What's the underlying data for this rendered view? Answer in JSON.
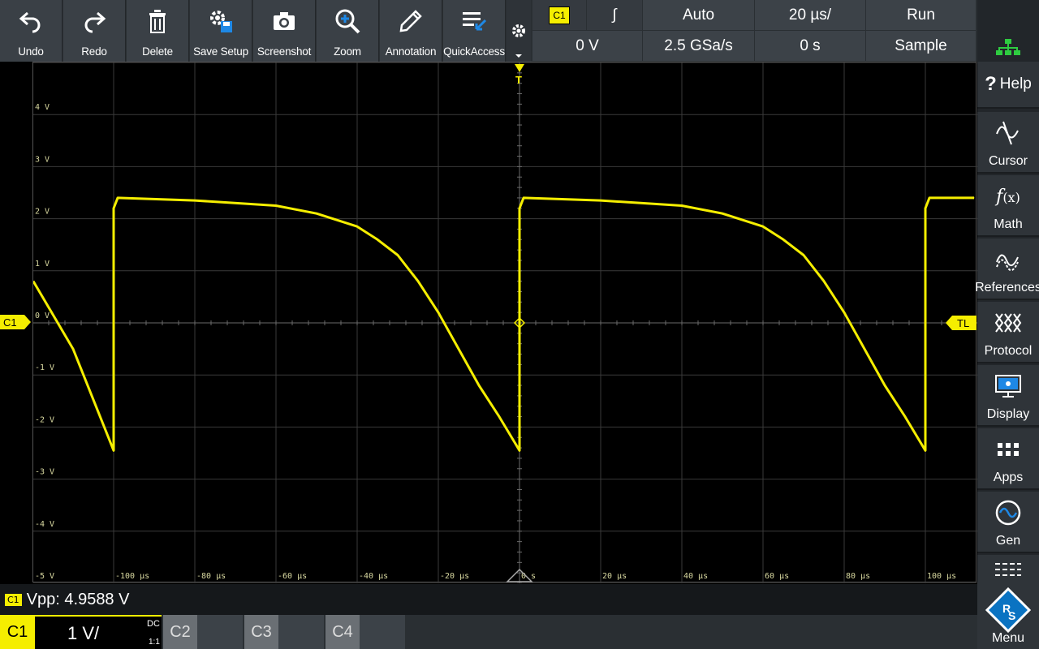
{
  "toolbar": {
    "buttons": [
      {
        "label": "Undo",
        "icon": "undo-icon"
      },
      {
        "label": "Redo",
        "icon": "redo-icon"
      },
      {
        "label": "Delete",
        "icon": "trash-icon"
      },
      {
        "label": "Save Setup",
        "icon": "save-setup-icon"
      },
      {
        "label": "Screenshot",
        "icon": "camera-icon"
      },
      {
        "label": "Zoom",
        "icon": "zoom-icon"
      },
      {
        "label": "Annotation",
        "icon": "pen-icon"
      },
      {
        "label": "QuickAccess",
        "icon": "quickaccess-icon"
      }
    ]
  },
  "status": {
    "trigger_channel": "C1",
    "trigger_slope": "∫",
    "trigger_mode": "Auto",
    "time_scale": "20 µs/",
    "run_state": "Run",
    "trigger_level": "0 V",
    "sample_rate": "2.5 GSa/s",
    "horizontal_position": "0 s",
    "acquisition_mode": "Sample"
  },
  "sidebar": {
    "items": [
      {
        "label": "Help",
        "icon": "help-icon"
      },
      {
        "label": "Cursor",
        "icon": "cursor-icon"
      },
      {
        "label": "Math",
        "icon": "math-icon"
      },
      {
        "label": "References",
        "icon": "references-icon"
      },
      {
        "label": "Protocol",
        "icon": "protocol-icon"
      },
      {
        "label": "Display",
        "icon": "display-icon"
      },
      {
        "label": "Apps",
        "icon": "apps-icon"
      },
      {
        "label": "Gen",
        "icon": "generator-icon"
      },
      {
        "label": "Menu",
        "icon": "rs-logo-icon"
      }
    ]
  },
  "scope": {
    "markers": {
      "channel": "C1",
      "trigger_top": "T",
      "trigger_level": "TL"
    },
    "colors": {
      "trace": "#f5ee00",
      "grid": "#3a3a3a",
      "axis": "#6a6a6a"
    }
  },
  "chart_data": {
    "type": "line",
    "y_tick_labels": [
      "4 V",
      "3 V",
      "2 V",
      "1 V",
      "0 V",
      "-1 V",
      "-2 V",
      "-3 V",
      "-4 V",
      "-5 V"
    ],
    "x_tick_labels": [
      "-100 µs",
      "-80 µs",
      "-60 µs",
      "-40 µs",
      "-20 µs",
      "0 s",
      "20 µs",
      "40 µs",
      "60 µs",
      "80 µs",
      "100 µs"
    ],
    "ylim": [
      -5,
      5
    ],
    "xlim": [
      -120,
      112
    ],
    "grid": true,
    "series": [
      {
        "x": [
          -120,
          -110,
          -100,
          -100,
          -99,
          -80,
          -60,
          -50,
          -40,
          -35,
          -30,
          -25,
          -20,
          -15,
          -10,
          -5,
          0,
          0,
          1,
          20,
          40,
          50,
          60,
          65,
          70,
          75,
          80,
          85,
          90,
          95,
          100,
          100,
          101,
          112
        ],
        "y": [
          0.8,
          -0.5,
          -2.45,
          2.2,
          2.4,
          2.35,
          2.25,
          2.1,
          1.85,
          1.6,
          1.3,
          0.8,
          0.2,
          -0.5,
          -1.2,
          -1.8,
          -2.45,
          2.2,
          2.4,
          2.35,
          2.25,
          2.1,
          1.85,
          1.6,
          1.3,
          0.8,
          0.2,
          -0.5,
          -1.2,
          -1.8,
          -2.45,
          2.2,
          2.4,
          2.4
        ]
      }
    ]
  },
  "measurement": {
    "channel": "C1",
    "text": "Vpp: 4.9588 V"
  },
  "channels": {
    "c1_label": "C1",
    "c1_scale": "1 V/",
    "c1_coupling": "DC",
    "c1_ratio": "1:1",
    "c2_label": "C2",
    "c3_label": "C3",
    "c4_label": "C4"
  }
}
